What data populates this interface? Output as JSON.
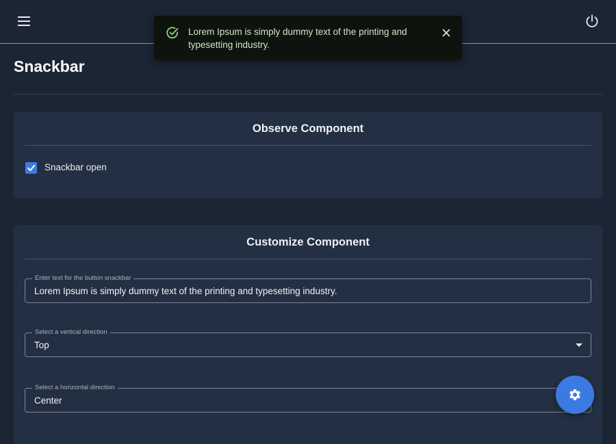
{
  "header": {
    "menu_icon": "menu-icon",
    "power_icon": "power-icon"
  },
  "snackbar": {
    "message": "Lorem Ipsum is simply dummy text of the printing and typesetting industry.",
    "status_icon": "check-circle-icon",
    "close_icon": "close-icon",
    "accent_color": "#8fd67a"
  },
  "page": {
    "title": "Snackbar"
  },
  "observe": {
    "title": "Observe Component",
    "checkbox_label": "Snackbar open",
    "checkbox_checked": true
  },
  "customize": {
    "title": "Customize Component",
    "text_field": {
      "label": "Enter text for the button snackbar",
      "value": "Lorem Ipsum is simply dummy text of the printing and typesetting industry."
    },
    "vertical_select": {
      "label": "Select a vertical direction",
      "value": "Top"
    },
    "horizontal_select": {
      "label": "Select a horizontal direction",
      "value": "Center"
    }
  },
  "fab": {
    "icon": "gear-icon",
    "color": "#3b7ae2"
  },
  "colors": {
    "background": "#1c2533",
    "card": "#232f42",
    "primary": "#3f7be0"
  }
}
